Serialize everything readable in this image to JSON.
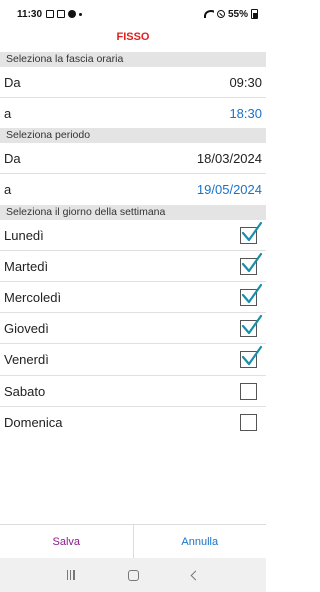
{
  "status_bar": {
    "time": "11:30",
    "battery": "55%"
  },
  "header": {
    "title": "FISSO"
  },
  "time_section": {
    "heading": "Seleziona la fascia oraria",
    "from_label": "Da",
    "from_value": "09:30",
    "to_label": "a",
    "to_value": "18:30"
  },
  "period_section": {
    "heading": "Seleziona periodo",
    "from_label": "Da",
    "from_value": "18/03/2024",
    "to_label": "a",
    "to_value": "19/05/2024"
  },
  "days_section": {
    "heading": "Seleziona il giorno della settimana",
    "days": [
      {
        "label": "Lunedì",
        "checked": true
      },
      {
        "label": "Martedì",
        "checked": true
      },
      {
        "label": "Mercoledì",
        "checked": true
      },
      {
        "label": "Giovedì",
        "checked": true
      },
      {
        "label": "Venerdì",
        "checked": true
      },
      {
        "label": "Sabato",
        "checked": false
      },
      {
        "label": "Domenica",
        "checked": false
      }
    ]
  },
  "footer": {
    "save_label": "Salva",
    "cancel_label": "Annulla"
  },
  "colors": {
    "title": "#e02020",
    "accent_blue": "#1a73c8",
    "save": "#8b1a8b",
    "check": "#1a8fa8"
  },
  "icons": [
    "gallery-icon",
    "camera-icon",
    "record-icon",
    "dot-icon",
    "wifi-icon",
    "do-not-disturb-icon",
    "battery-icon",
    "recents-icon",
    "home-icon",
    "back-icon"
  ]
}
